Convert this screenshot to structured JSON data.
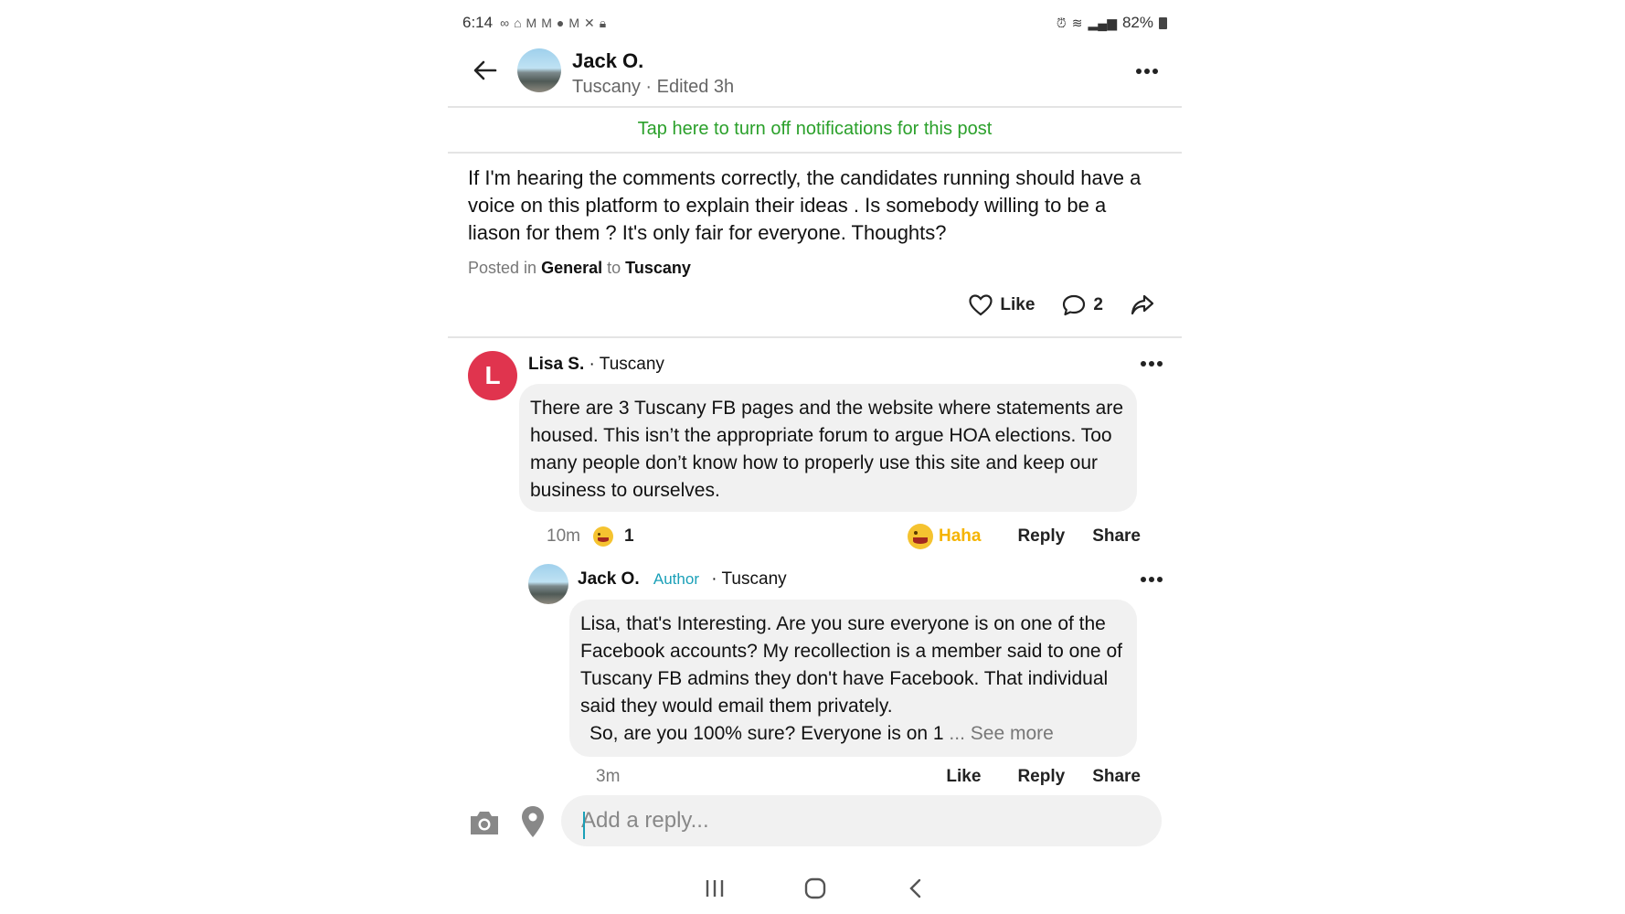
{
  "status_bar": {
    "time": "6:14",
    "battery": "82%"
  },
  "header": {
    "name": "Jack O.",
    "subtitle": "Tuscany · Edited 3h"
  },
  "notification_banner": "Tap here to turn off notifications for this post",
  "post": {
    "text": "If I'm hearing the comments correctly,  the candidates running should have a voice on this platform to explain their ideas .   Is somebody willing to be a liason for them ?  It's only fair for everyone.  Thoughts?",
    "posted_in_prefix": "Posted in",
    "category": "General",
    "to_word": "to",
    "neighborhood": "Tuscany",
    "like_label": "Like",
    "comment_count": "2"
  },
  "comments": [
    {
      "avatar_letter": "L",
      "name": "Lisa S.",
      "location": "· Tuscany",
      "text": "There are 3 Tuscany FB pages and the website where statements are housed. This isn’t the appropriate forum to argue HOA elections. Too many people don’t know how to properly use this site and keep our business to ourselves.",
      "time": "10m",
      "reaction_count": "1",
      "reaction_label": "Haha",
      "reply_label": "Reply",
      "share_label": "Share"
    },
    {
      "name": "Jack O.",
      "badge": "Author",
      "location": "· Tuscany",
      "text": "Lisa,  that's Interesting.  Are you sure everyone is on one of the Facebook accounts? My recollection is a member said to one of Tuscany FB admins they don't have Facebook. That individual said they would email them privately.",
      "text_last": "So, are you  100% sure? Everyone is on 1",
      "see_more": "... See more",
      "time": "3m",
      "like_label": "Like",
      "reply_label": "Reply",
      "share_label": "Share"
    }
  ],
  "reply_box": {
    "placeholder": "Add a reply..."
  },
  "colors": {
    "accent_green": "#2aa02a",
    "author_teal": "#1aa0b8",
    "avatar_red": "#e0344e",
    "haha_yellow": "#f5b400"
  }
}
